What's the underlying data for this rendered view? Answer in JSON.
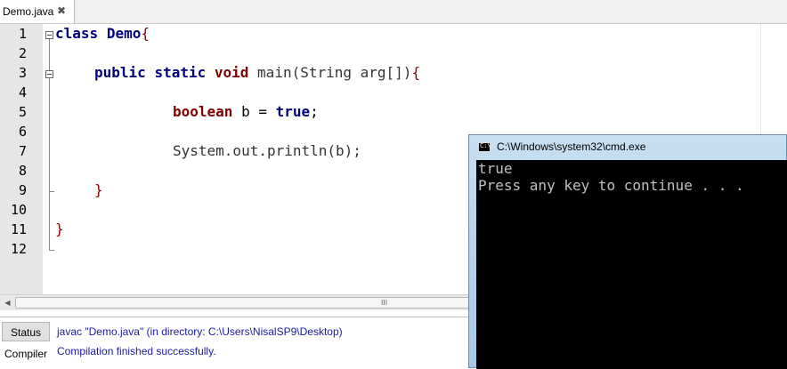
{
  "tab": {
    "label": "Demo.java",
    "close_symbol": "✖"
  },
  "editor": {
    "line_numbers": [
      "1",
      "2",
      "3",
      "4",
      "5",
      "6",
      "7",
      "8",
      "9",
      "10",
      "11",
      "12"
    ],
    "code": {
      "l1_kw": "class",
      "l1_name": "Demo",
      "l1_brace": "{",
      "l3_kw1": "public",
      "l3_kw2": "static",
      "l3_kw3": "void",
      "l3_rest": "main(String arg[])",
      "l3_brace": "{",
      "l5_kw": "boolean",
      "l5_mid": "b = ",
      "l5_val": "true",
      "l5_end": ";",
      "l7_text": "System.out.println(b);",
      "l9_brace": "}",
      "l11_brace": "}"
    }
  },
  "scrollbar": {
    "grip": "III"
  },
  "bottom_panel": {
    "tabs": [
      "Status",
      "Compiler"
    ],
    "messages": [
      "javac \"Demo.java\" (in directory: C:\\Users\\NisalSP9\\Desktop)",
      "Compilation finished successfully."
    ]
  },
  "cmd": {
    "title": "C:\\Windows\\system32\\cmd.exe",
    "icon_text": "C:\\",
    "output": [
      "true",
      "Press any key to continue . . ."
    ]
  },
  "icons": [
    "close-icon",
    "fold-icon",
    "cmd-icon",
    "scroll-left-icon"
  ]
}
